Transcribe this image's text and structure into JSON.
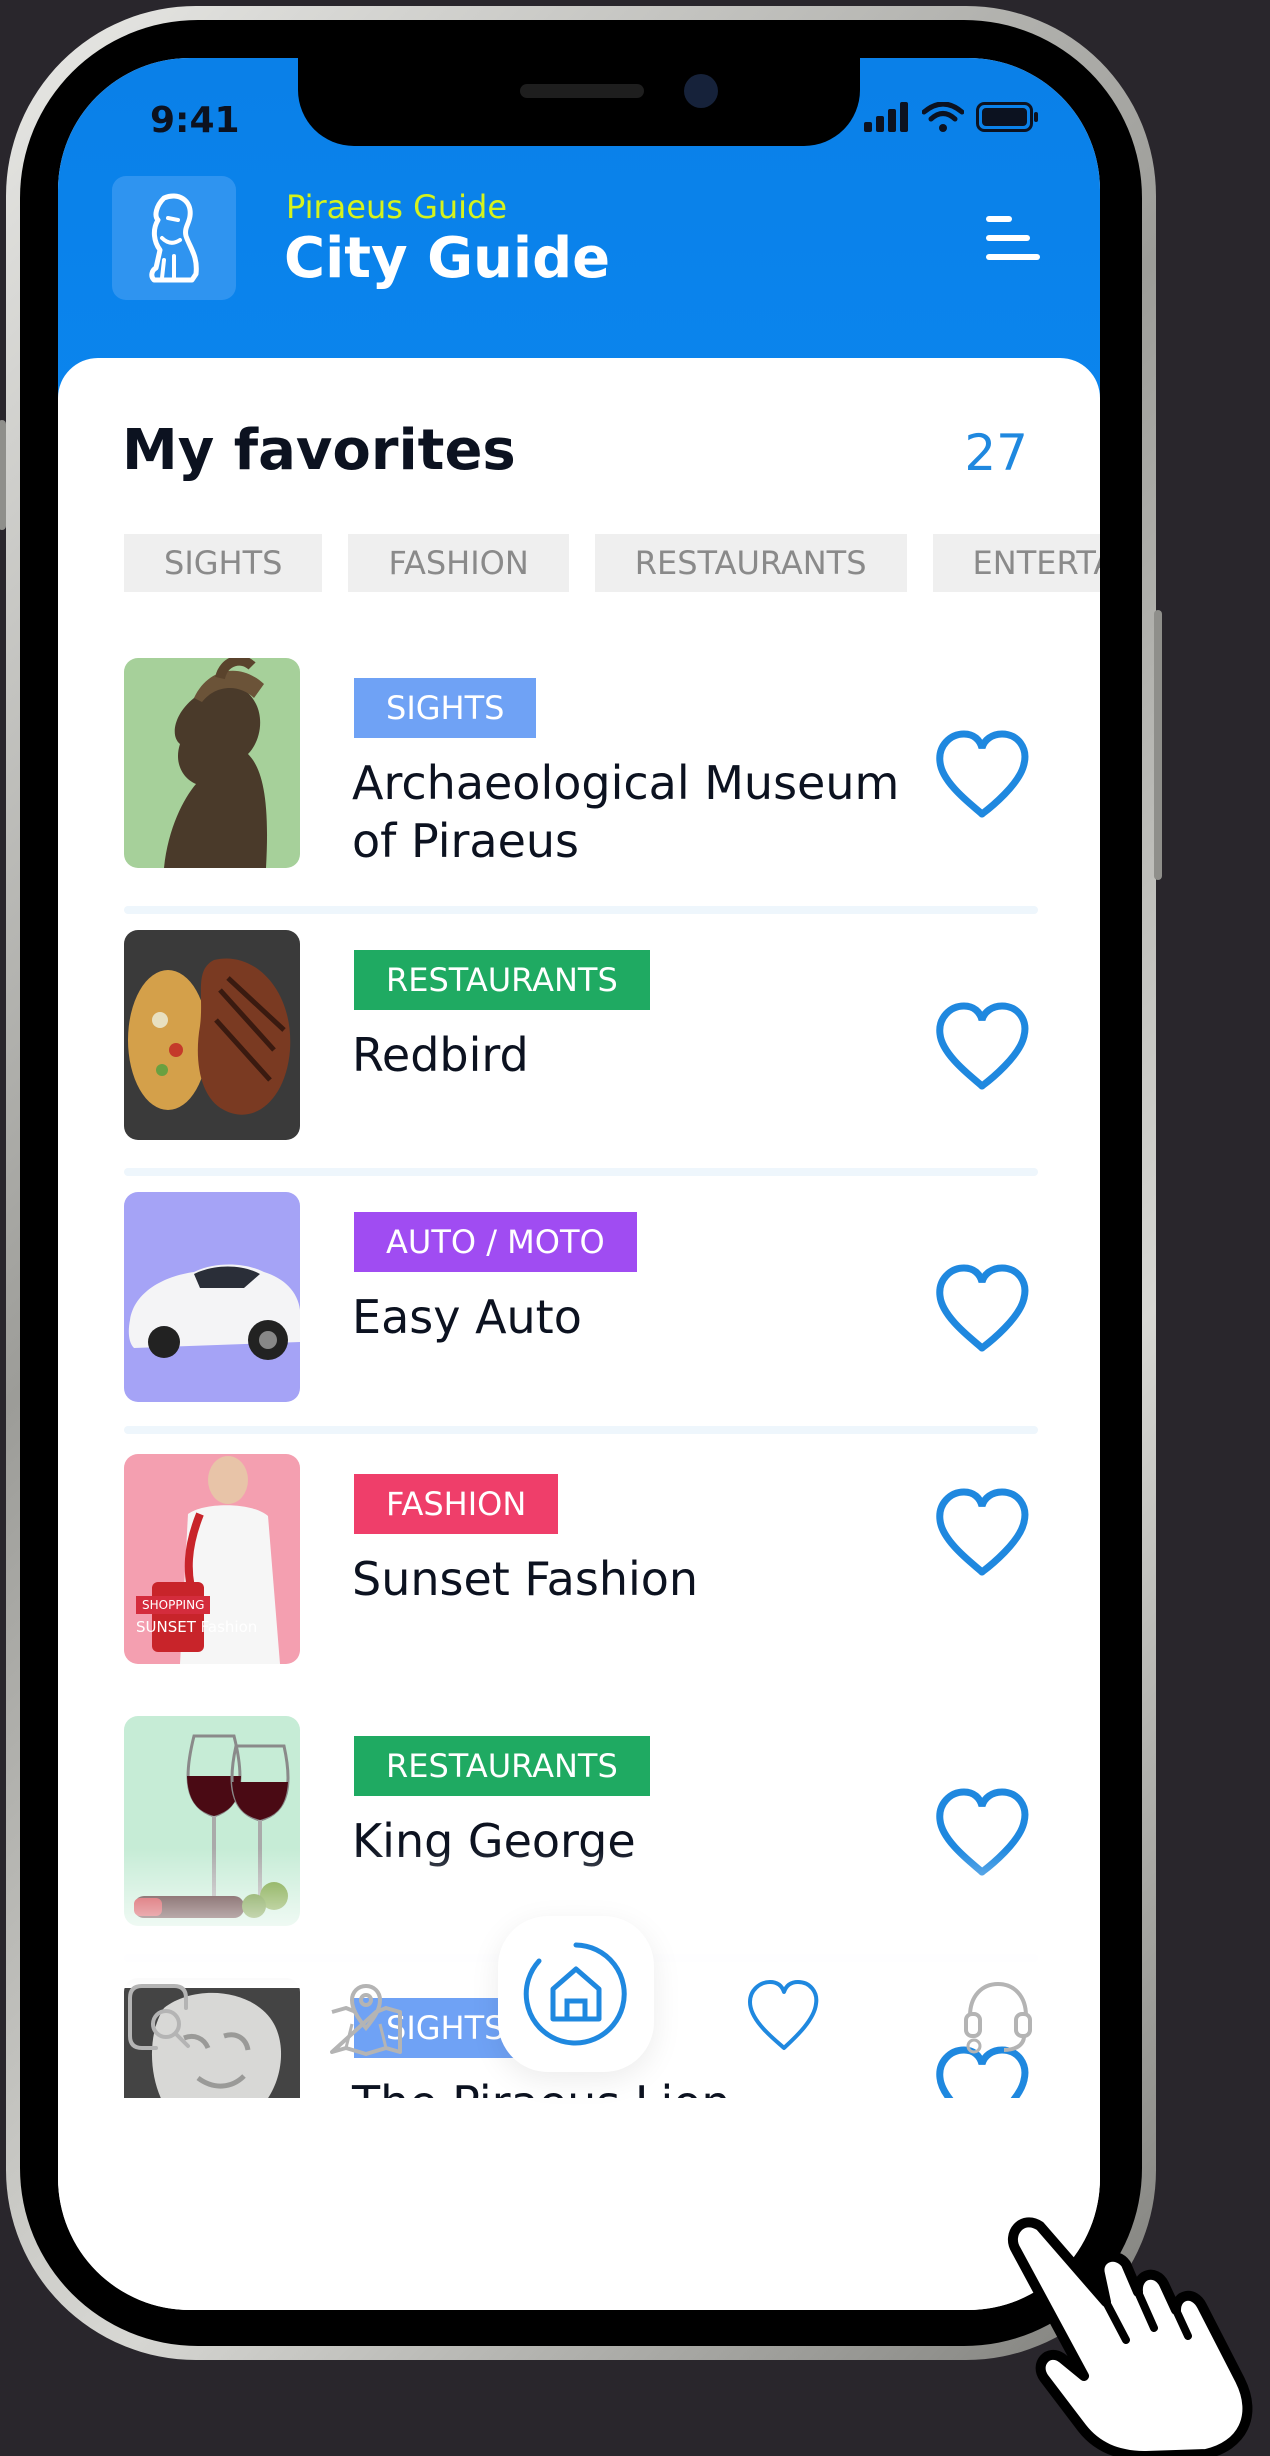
{
  "status_bar": {
    "time": "9:41"
  },
  "header": {
    "kicker": "Piraeus Guide",
    "title": "City Guide",
    "logo_icon": "lion-icon",
    "menu_icon": "menu-icon"
  },
  "favorites": {
    "title": "My favorites",
    "count": "27"
  },
  "filters": [
    "SIGHTS",
    "FASHION",
    "RESTAURANTS",
    "ENTERTA"
  ],
  "items": [
    {
      "category": "SIGHTS",
      "category_color": "#6fa2f5",
      "name": "Archaeological Museum of Piraeus",
      "thumb_bg": "#a6d09a",
      "thumb_icon": "bronze-bust-image"
    },
    {
      "category": "RESTAURANTS",
      "category_color": "#1faa62",
      "name": "Redbird",
      "thumb_bg": "#3a3a3a",
      "thumb_icon": "steak-image"
    },
    {
      "category": "AUTO / MOTO",
      "category_color": "#a04cf2",
      "name": "Easy Auto",
      "thumb_bg": "#a5a3f6",
      "thumb_icon": "car-image"
    },
    {
      "category": "FASHION",
      "category_color": "#ef3e6a",
      "name": "Sunset Fashion",
      "thumb_bg": "#f49fb0",
      "thumb_icon": "fashion-model-image",
      "thumb_text": [
        "SHOPPING",
        "SUNSET Fashion"
      ]
    },
    {
      "category": "RESTAURANTS",
      "category_color": "#1faa62",
      "name": "King George",
      "thumb_bg": "#c6ecd6",
      "thumb_icon": "wine-glasses-image"
    },
    {
      "category": "SIGHTS",
      "category_color": "#6fa2f5",
      "name": "The Piraeus Lion",
      "thumb_bg": "#444444",
      "thumb_icon": "lion-statue-image"
    }
  ],
  "tabbar": {
    "tabs": [
      "search-icon",
      "map-icon",
      "home-icon",
      "heart-icon",
      "headset-icon"
    ],
    "active": "home-icon"
  },
  "colors": {
    "brand_blue": "#0b83ec",
    "accent_yellow": "#d6f31c",
    "heart_blue": "#1f88df"
  }
}
